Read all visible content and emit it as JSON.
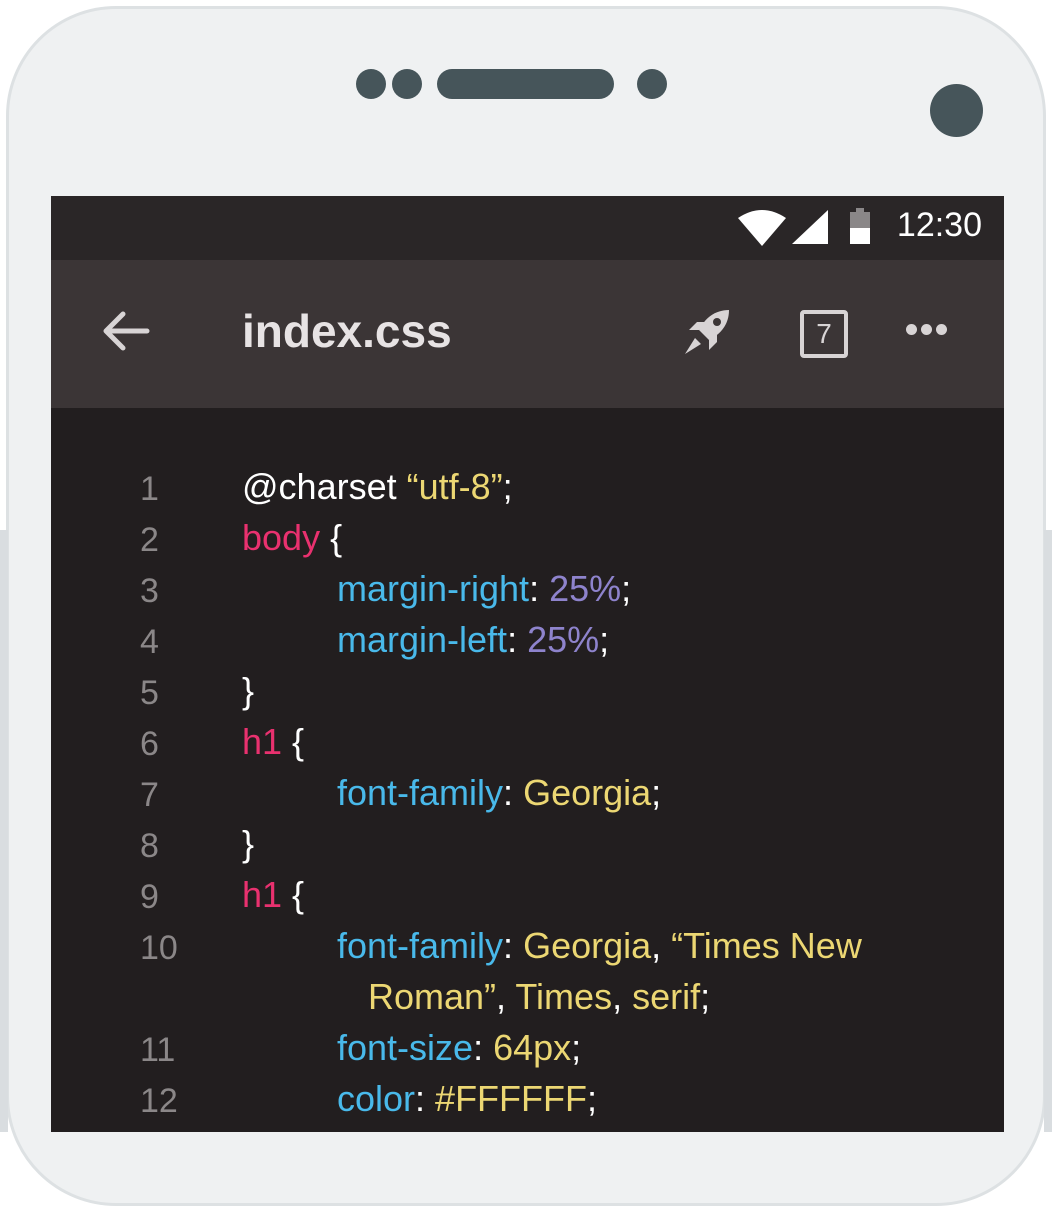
{
  "status": {
    "time": "12:30",
    "icons": [
      "wifi-icon",
      "signal-icon",
      "battery-icon"
    ]
  },
  "appbar": {
    "title": "index.css",
    "back_icon": "arrow-left-icon",
    "run_icon": "rocket-icon",
    "tab_count": "7",
    "more_icon": "more-horizontal-icon"
  },
  "colors": {
    "selector": "#e9316f",
    "property": "#49b9ea",
    "string": "#ecd773",
    "number": "#8e83cc",
    "punctuation": "#ffffff",
    "background": "#221e1f",
    "appbar": "#3b3536",
    "statusbar": "#2a2627"
  },
  "code_lines": [
    {
      "num": "1",
      "tokens": [
        {
          "t": "@charset ",
          "k": "punc"
        },
        {
          "t": "“utf-8”",
          "k": "str"
        },
        {
          "t": ";",
          "k": "punc"
        }
      ]
    },
    {
      "num": "2",
      "tokens": [
        {
          "t": "body",
          "k": "sel"
        },
        {
          "t": " {",
          "k": "punc"
        }
      ]
    },
    {
      "num": "3",
      "indent": 1,
      "tokens": [
        {
          "t": "margin-right",
          "k": "prop"
        },
        {
          "t": ": ",
          "k": "punc"
        },
        {
          "t": "25%",
          "k": "num"
        },
        {
          "t": ";",
          "k": "punc"
        }
      ]
    },
    {
      "num": "4",
      "indent": 1,
      "tokens": [
        {
          "t": "margin-left",
          "k": "prop"
        },
        {
          "t": ": ",
          "k": "punc"
        },
        {
          "t": "25%",
          "k": "num"
        },
        {
          "t": ";",
          "k": "punc"
        }
      ]
    },
    {
      "num": "5",
      "tokens": [
        {
          "t": "}",
          "k": "punc"
        }
      ]
    },
    {
      "num": "6",
      "tokens": [
        {
          "t": "h1",
          "k": "sel"
        },
        {
          "t": " {",
          "k": "punc"
        }
      ]
    },
    {
      "num": "7",
      "indent": 1,
      "tokens": [
        {
          "t": "font-family",
          "k": "prop"
        },
        {
          "t": ": ",
          "k": "punc"
        },
        {
          "t": "Georgia",
          "k": "str"
        },
        {
          "t": ";",
          "k": "punc"
        }
      ]
    },
    {
      "num": "8",
      "tokens": [
        {
          "t": "}",
          "k": "punc"
        }
      ]
    },
    {
      "num": "9",
      "tokens": [
        {
          "t": "h1",
          "k": "sel"
        },
        {
          "t": " {",
          "k": "punc"
        }
      ]
    },
    {
      "num": "10",
      "indent": 1,
      "tokens": [
        {
          "t": "font-family",
          "k": "prop"
        },
        {
          "t": ": ",
          "k": "punc"
        },
        {
          "t": "Georgia",
          "k": "str"
        },
        {
          "t": ", ",
          "k": "punc"
        },
        {
          "t": "“Times New",
          "k": "str"
        }
      ]
    },
    {
      "num": "",
      "indent": 2,
      "tokens": [
        {
          "t": "Roman”",
          "k": "str"
        },
        {
          "t": ", ",
          "k": "punc"
        },
        {
          "t": "Times",
          "k": "str"
        },
        {
          "t": ", ",
          "k": "punc"
        },
        {
          "t": "serif",
          "k": "str"
        },
        {
          "t": ";",
          "k": "punc"
        }
      ]
    },
    {
      "num": "11",
      "indent": 1,
      "tokens": [
        {
          "t": "font-size",
          "k": "prop"
        },
        {
          "t": ": ",
          "k": "punc"
        },
        {
          "t": "64px",
          "k": "str"
        },
        {
          "t": ";",
          "k": "punc"
        }
      ]
    },
    {
      "num": "12",
      "indent": 1,
      "tokens": [
        {
          "t": "color",
          "k": "prop"
        },
        {
          "t": ": ",
          "k": "punc"
        },
        {
          "t": "#FFFFFF",
          "k": "str"
        },
        {
          "t": ";",
          "k": "punc"
        }
      ]
    }
  ]
}
